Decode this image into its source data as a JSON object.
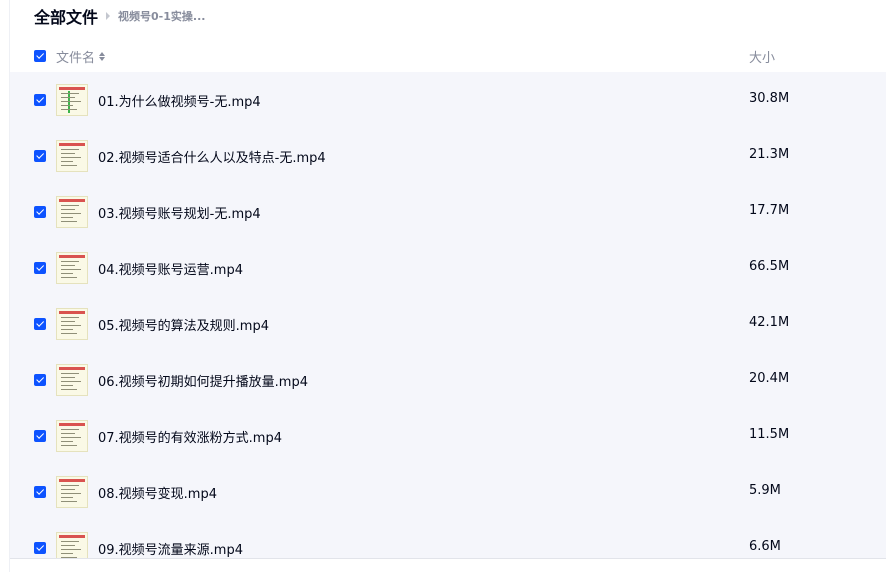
{
  "breadcrumb": {
    "root": "全部文件",
    "current": "视频号0-1实操..."
  },
  "table": {
    "columns": {
      "name": "文件名",
      "size": "大小"
    },
    "all_selected": true,
    "rows": [
      {
        "name": "01.为什么做视频号-无.mp4",
        "size": "30.8M",
        "selected": true
      },
      {
        "name": "02.视频号适合什么人以及特点-无.mp4",
        "size": "21.3M",
        "selected": true
      },
      {
        "name": "03.视频号账号规划-无.mp4",
        "size": "17.7M",
        "selected": true
      },
      {
        "name": "04.视频号账号运营.mp4",
        "size": "66.5M",
        "selected": true
      },
      {
        "name": "05.视频号的算法及规则.mp4",
        "size": "42.1M",
        "selected": true
      },
      {
        "name": "06.视频号初期如何提升播放量.mp4",
        "size": "20.4M",
        "selected": true
      },
      {
        "name": "07.视频号的有效涨粉方式.mp4",
        "size": "11.5M",
        "selected": true
      },
      {
        "name": "08.视频号变现.mp4",
        "size": "5.9M",
        "selected": true
      },
      {
        "name": "09.视频号流量来源.mp4",
        "size": "6.6M",
        "selected": true
      }
    ]
  },
  "icons": {
    "file_thumbnail": "video-thumbnail-icon",
    "sort": "sort-updown-icon",
    "separator": "chevron-right-icon",
    "checkbox": "checkbox-checked-icon"
  },
  "colors": {
    "accent": "#0d53ff",
    "text": "#03081a",
    "muted": "#878c9c",
    "row_bg": "#f5f6fb"
  }
}
